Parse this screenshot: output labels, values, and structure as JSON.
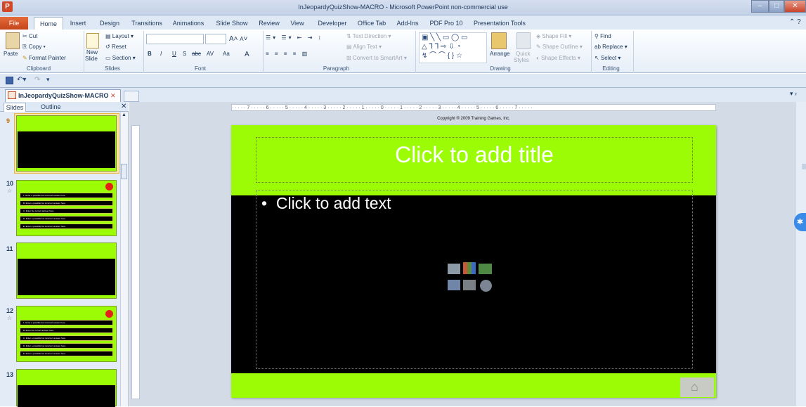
{
  "window": {
    "title": "InJeopardyQuizShow-MACRO - Microsoft PowerPoint non-commercial use",
    "app_icon": "P"
  },
  "ribbon_tabs": [
    "File",
    "Home",
    "Insert",
    "Design",
    "Transitions",
    "Animations",
    "Slide Show",
    "Review",
    "View",
    "Developer",
    "Office Tab",
    "Add-Ins",
    "PDF Pro 10",
    "Presentation Tools"
  ],
  "clipboard": {
    "paste": "Paste",
    "cut": "Cut",
    "copy": "Copy",
    "format_painter": "Format Painter",
    "label": "Clipboard"
  },
  "slides": {
    "new_slide": "New",
    "new_slide2": "Slide",
    "layout": "Layout",
    "reset": "Reset",
    "section": "Section",
    "label": "Slides"
  },
  "font": {
    "label": "Font",
    "bold": "B",
    "italic": "I",
    "underline": "U",
    "shadow": "S",
    "strike": "abc",
    "spacing": "AV",
    "case": "Aa",
    "color": "A",
    "grow": "A",
    "shrink": "A"
  },
  "paragraph": {
    "label": "Paragraph",
    "text_direction": "Text Direction",
    "align_text": "Align Text",
    "smartart": "Convert to SmartArt"
  },
  "drawing": {
    "label": "Drawing",
    "arrange": "Arrange",
    "quick": "Quick",
    "styles": "Styles",
    "shape_fill": "Shape Fill",
    "shape_outline": "Shape Outline",
    "shape_effects": "Shape Effects"
  },
  "editing": {
    "label": "Editing",
    "find": "Find",
    "replace": "Replace",
    "select": "Select"
  },
  "doc_tab": {
    "name": "InJeopardyQuizShow-MACRO"
  },
  "pane": {
    "slides_tab": "Slides",
    "outline_tab": "Outline"
  },
  "thumbnails": [
    {
      "num": "9",
      "type": "blank"
    },
    {
      "num": "10",
      "type": "question",
      "rows": [
        "1. Enter a possible but incorrect answer here.",
        "B. Enter a possible but incorrect answer here.",
        "C. Enter the correct answer here.",
        "D. Enter a possible but incorrect answer here.",
        "E. Enter a possible but incorrect answer here."
      ]
    },
    {
      "num": "11",
      "type": "blank"
    },
    {
      "num": "12",
      "type": "question",
      "rows": [
        "1. Enter a possible but incorrect answer here.",
        "B. Enter the correct answer here.",
        "C. Enter a possible but incorrect answer here.",
        "D. Enter a possible but incorrect answer here.",
        "E. Enter a possible but incorrect answer here."
      ]
    },
    {
      "num": "13",
      "type": "blank"
    }
  ],
  "slide": {
    "copyright": "Copyright ® 2009 Training Games, Inc.",
    "title_placeholder": "Click to add title",
    "body_placeholder": "Click to add text",
    "bullet": "•"
  },
  "ruler": "· · · · · 7 · · · · · 6 · · · · · 5 · · · · · 4 · · · · · 3 · · · · · 2 · · · · · 1 · · · · · 0 · · · · · 1 · · · · · 2 · · · · · 3 · · · · · 4 · · · · · 5 · · · · · 6 · · · · · 7 · · · · ·",
  "colors": {
    "slide_green": "#9bfc06",
    "slide_black": "#000000",
    "file_tab": "#d24726"
  }
}
